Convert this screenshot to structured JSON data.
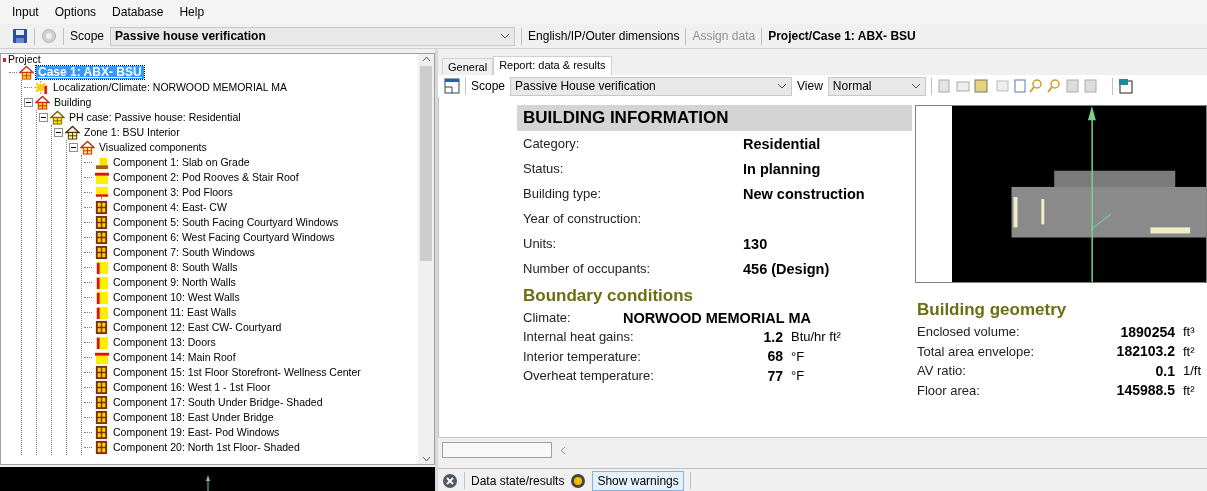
{
  "menu": [
    "Input",
    "Options",
    "Database",
    "Help"
  ],
  "toolbar": {
    "scope_label": "Scope",
    "scope_value": "Passive house verification",
    "units": "English/IP/Outer dimensions",
    "assign": {
      "label": "Assign data",
      "disabled": true
    },
    "project": "Project/Case 1: ABX- BSU"
  },
  "tree": {
    "root": "Project",
    "items": [
      {
        "label": "Case 1: ABX- BSU",
        "kind": "case",
        "selected": true,
        "children": [
          {
            "label": "Localization/Climate: NORWOOD MEMORIAL MA",
            "kind": "climate",
            "selected": false
          },
          {
            "label": "Building",
            "kind": "building",
            "selected": false,
            "expanded": true,
            "children": [
              {
                "label": "PH case: Passive house: Residential",
                "kind": "phcase",
                "selected": false,
                "expanded": true,
                "children": [
                  {
                    "label": "Zone 1: BSU Interior",
                    "kind": "zone",
                    "selected": false,
                    "expanded": true,
                    "children": [
                      {
                        "label": "Visualized components",
                        "kind": "components",
                        "selected": false,
                        "expanded": true,
                        "children": [
                          {
                            "label": "Component 1: Slab on Grade",
                            "kind": "slab",
                            "selected": false
                          },
                          {
                            "label": "Component 2: Pod Rooves & Stair Roof",
                            "kind": "roof",
                            "selected": false
                          },
                          {
                            "label": "Component 3: Pod Floors",
                            "kind": "floor",
                            "selected": false
                          },
                          {
                            "label": "Component 4: East- CW",
                            "kind": "window",
                            "selected": false
                          },
                          {
                            "label": "Component 5: South Facing Courtyard Windows",
                            "kind": "window",
                            "selected": false
                          },
                          {
                            "label": "Component 6: West Facing Courtyard Windows",
                            "kind": "window",
                            "selected": false
                          },
                          {
                            "label": "Component 7: South Windows",
                            "kind": "window",
                            "selected": false
                          },
                          {
                            "label": "Component 8: South Walls",
                            "kind": "wall",
                            "selected": false
                          },
                          {
                            "label": "Component 9: North Walls",
                            "kind": "wall",
                            "selected": false
                          },
                          {
                            "label": "Component 10: West Walls",
                            "kind": "wall",
                            "selected": false
                          },
                          {
                            "label": "Component 11: East Walls",
                            "kind": "wall",
                            "selected": false
                          },
                          {
                            "label": "Component 12: East CW- Courtyard",
                            "kind": "window",
                            "selected": false
                          },
                          {
                            "label": "Component 13: Doors",
                            "kind": "wall",
                            "selected": false
                          },
                          {
                            "label": "Component 14: Main Roof",
                            "kind": "roof",
                            "selected": false
                          },
                          {
                            "label": "Component 15: 1st Floor Storefront- Wellness Center",
                            "kind": "window",
                            "selected": false
                          },
                          {
                            "label": "Component 16: West 1 - 1st Floor",
                            "kind": "window",
                            "selected": false
                          },
                          {
                            "label": "Component 17: South Under Bridge- Shaded",
                            "kind": "window",
                            "selected": false
                          },
                          {
                            "label": "Component 18: East Under Bridge",
                            "kind": "window",
                            "selected": false
                          },
                          {
                            "label": "Component 19: East- Pod Windows",
                            "kind": "window",
                            "selected": false
                          },
                          {
                            "label": "Component 20: North 1st Floor- Shaded",
                            "kind": "window",
                            "selected": false
                          }
                        ]
                      }
                    ]
                  }
                ]
              }
            ]
          }
        ]
      }
    ]
  },
  "tabs": [
    {
      "label": "General",
      "selected": false
    },
    {
      "label": "Report: data & results",
      "selected": true
    }
  ],
  "report_toolbar": {
    "scope_label": "Scope",
    "scope_value": "Passive House verification",
    "view_label": "View",
    "view_value": "Normal"
  },
  "building_information": {
    "title": "BUILDING INFORMATION",
    "rows": [
      {
        "label": "Category:",
        "value": "Residential"
      },
      {
        "label": "Status:",
        "value": "In planning"
      },
      {
        "label": "Building type:",
        "value": "New construction"
      },
      {
        "label": "Year of construction:"
      },
      {
        "label": "Units:",
        "value": "130"
      },
      {
        "label": "Number of occupants:",
        "value": "456 (Design)"
      }
    ]
  },
  "boundary_conditions": {
    "title": "Boundary conditions",
    "climate": {
      "label": "Climate:",
      "value": "NORWOOD MEMORIAL MA"
    },
    "rows": [
      {
        "label": "Internal heat gains:",
        "value": "1.2",
        "unit": "Btu/hr ft²"
      },
      {
        "label": "Interior temperature:",
        "value": "68",
        "unit": "°F"
      },
      {
        "label": "Overheat temperature:",
        "value": "77",
        "unit": "°F"
      }
    ]
  },
  "building_geometry": {
    "title": "Building geometry",
    "rows": [
      {
        "label": "Enclosed volume:",
        "value": "1890254",
        "unit": "ft³"
      },
      {
        "label": "Total area envelope:",
        "value": "182103.2",
        "unit": "ft²"
      },
      {
        "label": "AV ratio:",
        "value": "0.1",
        "unit": "1/ft"
      },
      {
        "label": "Floor area:",
        "value": "145988.5",
        "unit": "ft²"
      }
    ]
  },
  "status_bar": {
    "data_state": "Data state/results",
    "warnings_button": "Show warnings"
  }
}
